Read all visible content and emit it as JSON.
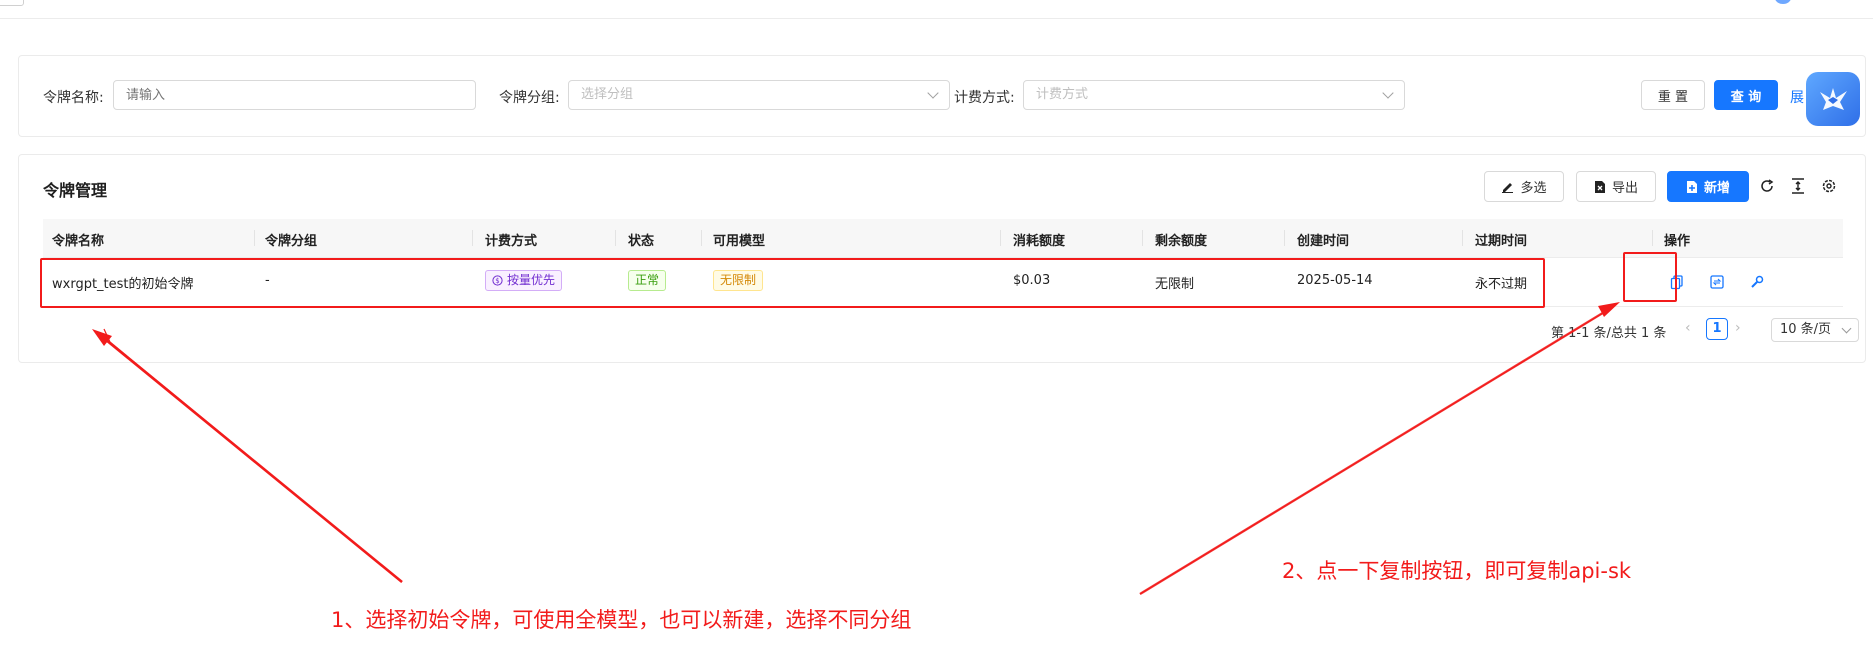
{
  "search": {
    "name_label": "令牌名称:",
    "name_placeholder": "请输入",
    "group_label": "令牌分组:",
    "group_placeholder": "选择分组",
    "billing_label": "计费方式:",
    "billing_placeholder": "计费方式",
    "reset_label": "重 置",
    "query_label": "查 询",
    "expand_label": "展"
  },
  "toolbar": {
    "title": "令牌管理",
    "multiselect_label": "多选",
    "export_label": "导出",
    "add_label": "新增",
    "icons": [
      "refresh-icon",
      "column-height-icon",
      "settings-icon"
    ]
  },
  "table": {
    "columns": [
      "令牌名称",
      "令牌分组",
      "计费方式",
      "状态",
      "可用模型",
      "消耗额度",
      "剩余额度",
      "创建时间",
      "过期时间",
      "操作"
    ],
    "rows": [
      {
        "name": "wxrgpt_test的初始令牌",
        "group": "-",
        "billing": "按量优先",
        "status": "正常",
        "models": "无限制",
        "used": "$0.03",
        "remaining": "无限制",
        "created": "2025-05-14",
        "expires": "永不过期",
        "actions": [
          "copy-icon",
          "switch-icon",
          "edit-tool-icon"
        ]
      }
    ]
  },
  "pagination": {
    "summary": "第 1-1 条/总共 1 条",
    "current_page": "1",
    "page_size": "10 条/页"
  },
  "annotations": {
    "note1": "1、选择初始令牌，可使用全模型，也可以新建，选择不同分组",
    "note2": "2、点一下复制按钮，即可复制api-sk"
  },
  "colors": {
    "primary": "#1677ff",
    "annotation_red": "#f21b1b",
    "tag_purple": "#722ed1",
    "tag_green": "#389e0d",
    "tag_gold": "#d48806"
  }
}
